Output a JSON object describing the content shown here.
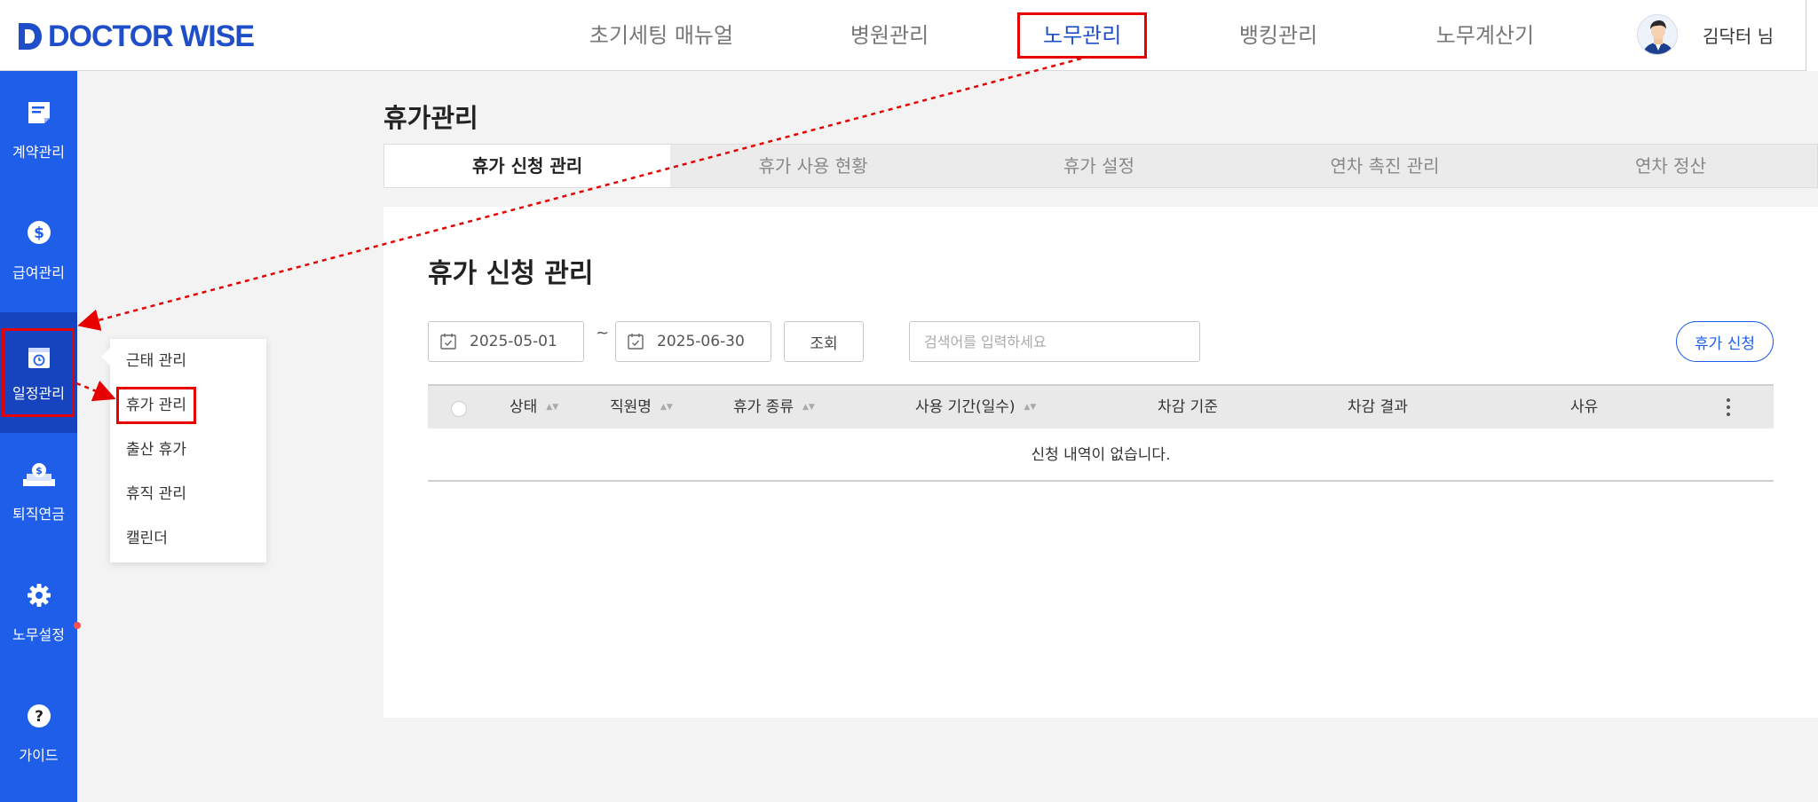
{
  "brand": {
    "name": "DOCTOR WISE"
  },
  "top_nav": [
    {
      "label": "초기세팅 매뉴얼"
    },
    {
      "label": "병원관리"
    },
    {
      "label": "노무관리",
      "active": true
    },
    {
      "label": "뱅킹관리"
    },
    {
      "label": "노무계산기"
    }
  ],
  "user": {
    "name": "김닥터 님"
  },
  "sidebar": [
    {
      "label": "계약관리",
      "icon": "contract-icon"
    },
    {
      "label": "급여관리",
      "icon": "dollar-icon"
    },
    {
      "label": "일정관리",
      "icon": "schedule-icon",
      "active": true
    },
    {
      "label": "퇴직연금",
      "icon": "pension-icon"
    },
    {
      "label": "노무설정",
      "icon": "gear-icon"
    },
    {
      "label": "가이드",
      "icon": "question-icon"
    }
  ],
  "submenu": [
    {
      "label": "근태 관리"
    },
    {
      "label": "휴가 관리",
      "active": true
    },
    {
      "label": "출산 휴가"
    },
    {
      "label": "휴직 관리"
    },
    {
      "label": "캘린더"
    }
  ],
  "page": {
    "title": "휴가관리"
  },
  "tabs": [
    {
      "label": "휴가 신청 관리",
      "active": true
    },
    {
      "label": "휴가 사용 현황"
    },
    {
      "label": "휴가 설정"
    },
    {
      "label": "연차 촉진 관리"
    },
    {
      "label": "연차 정산"
    }
  ],
  "panel": {
    "title": "휴가 신청 관리",
    "date_from": "2025-05-01",
    "date_separator": "~",
    "date_to": "2025-06-30",
    "search_button": "조회",
    "search_placeholder": "검색어를 입력하세요",
    "apply_button": "휴가 신청"
  },
  "table": {
    "columns": [
      "상태",
      "직원명",
      "휴가 종류",
      "사용 기간(일수)",
      "차감 기준",
      "차감 결과",
      "사유"
    ],
    "empty_message": "신청 내역이 없습니다."
  },
  "colors": {
    "accent": "#1f5ee8",
    "highlight": "#e60000"
  }
}
